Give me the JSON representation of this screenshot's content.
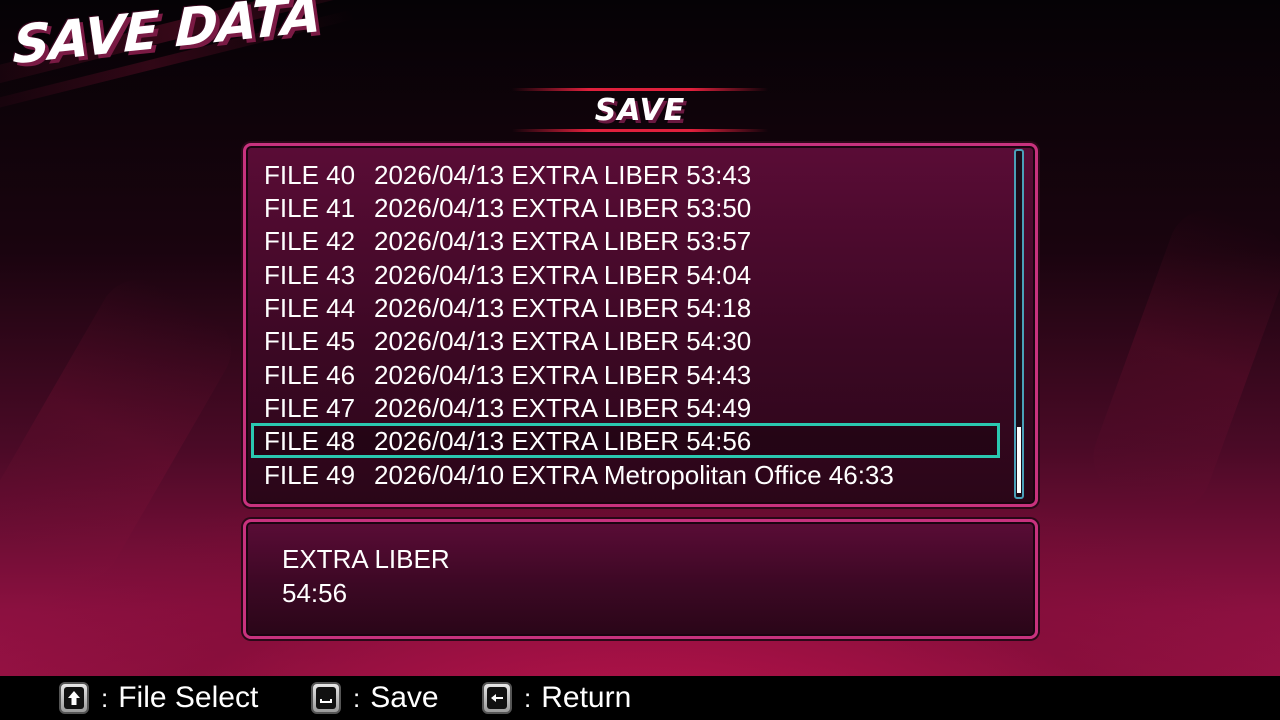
{
  "screen_title": "SAVE DATA",
  "mode_label": "SAVE",
  "files": [
    {
      "name": "FILE 40",
      "desc": "2026/04/13 EXTRA LIBER 53:43"
    },
    {
      "name": "FILE 41",
      "desc": "2026/04/13 EXTRA LIBER 53:50"
    },
    {
      "name": "FILE 42",
      "desc": "2026/04/13 EXTRA LIBER 53:57"
    },
    {
      "name": "FILE 43",
      "desc": "2026/04/13 EXTRA LIBER 54:04"
    },
    {
      "name": "FILE 44",
      "desc": "2026/04/13 EXTRA LIBER 54:18"
    },
    {
      "name": "FILE 45",
      "desc": "2026/04/13 EXTRA LIBER 54:30"
    },
    {
      "name": "FILE 46",
      "desc": "2026/04/13 EXTRA LIBER 54:43"
    },
    {
      "name": "FILE 47",
      "desc": "2026/04/13 EXTRA LIBER 54:49"
    },
    {
      "name": "FILE 48",
      "desc": "2026/04/13 EXTRA LIBER 54:56"
    },
    {
      "name": "FILE 49",
      "desc": "2026/04/10 EXTRA Metropolitan Office 46:33"
    }
  ],
  "selected_file": "FILE 48",
  "detail": {
    "location": "EXTRA LIBER",
    "playtime": "54:56"
  },
  "controls": [
    {
      "icon": "up-arrow-key-icon",
      "separator": ":",
      "label": "File Select"
    },
    {
      "icon": "space-key-icon",
      "separator": ":",
      "label": "Save"
    },
    {
      "icon": "backspace-key-icon",
      "separator": ":",
      "label": "Return"
    }
  ],
  "colors": {
    "panel_border": "#c8327e",
    "selector": "#2ac8b0",
    "header_line": "#e0203c"
  }
}
